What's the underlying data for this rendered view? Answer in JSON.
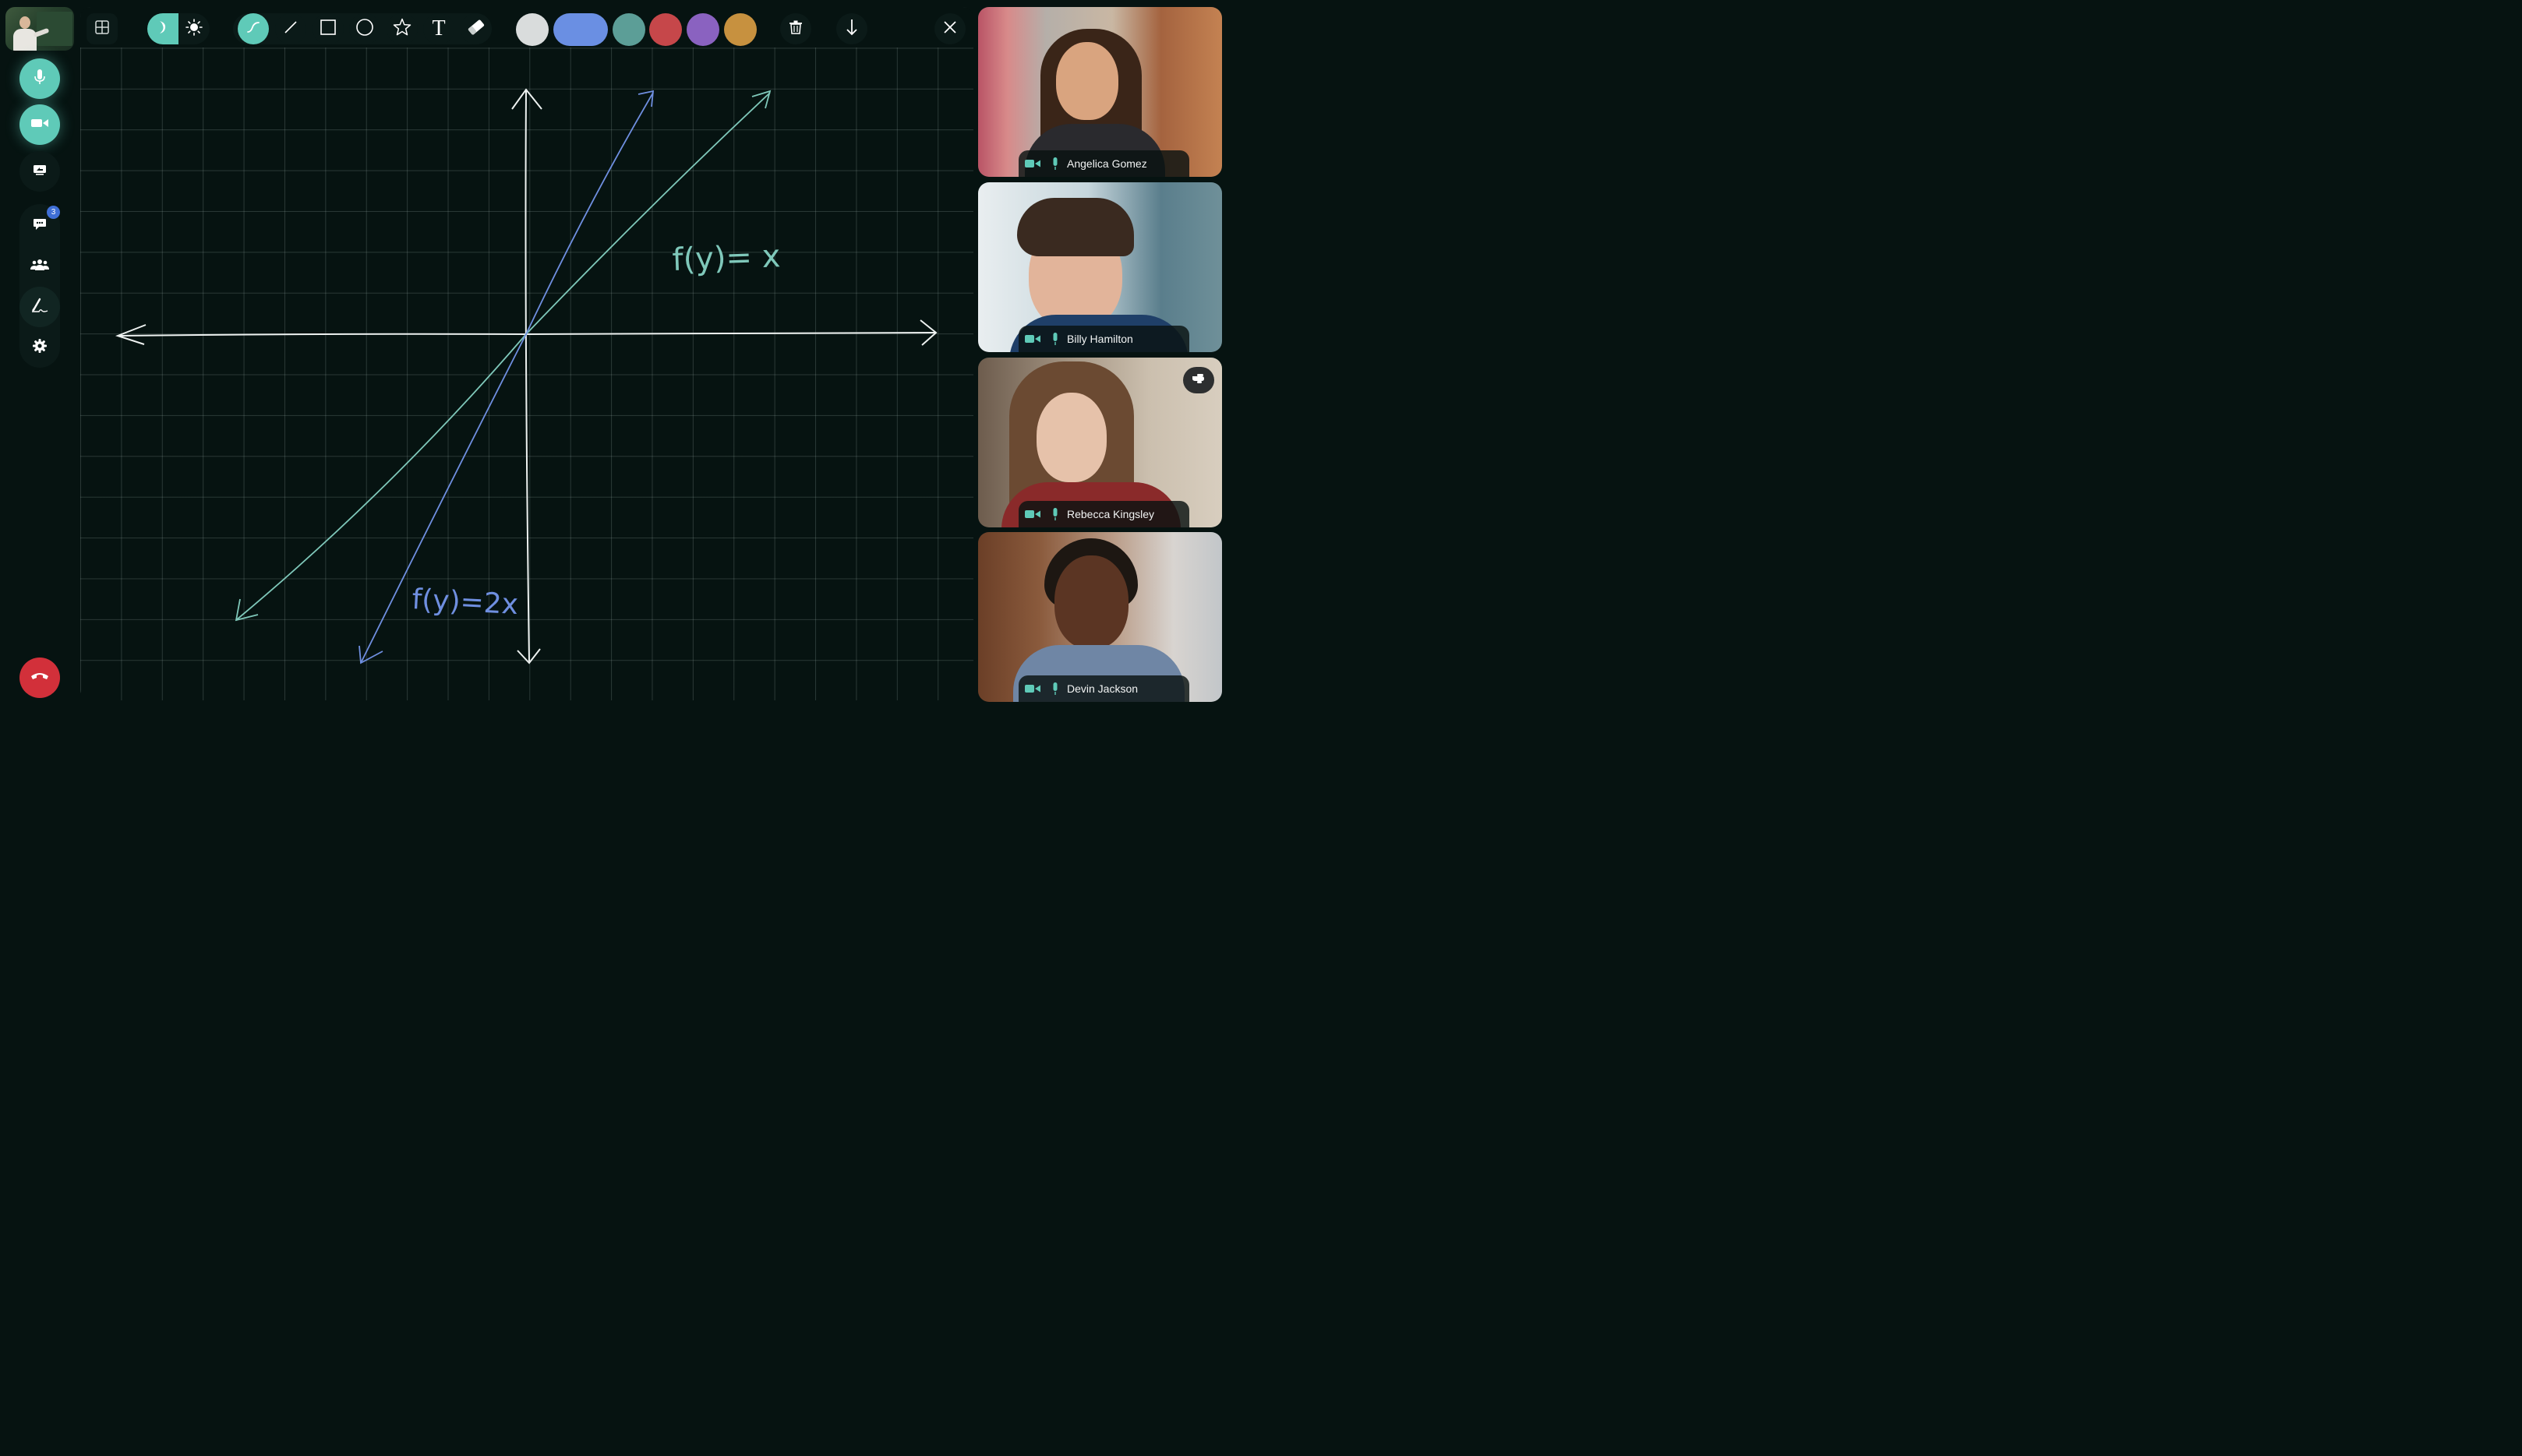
{
  "rail": {
    "self_thumbnail": "self-video-thumbnail",
    "buttons": [
      {
        "name": "microphone",
        "icon": "microphone-icon",
        "state": "on"
      },
      {
        "name": "camera",
        "icon": "video-camera-icon",
        "state": "on"
      },
      {
        "name": "screen-share",
        "icon": "screen-share-icon"
      },
      {
        "name": "chat",
        "icon": "chat-bubble-icon",
        "badge": "3"
      },
      {
        "name": "participants",
        "icon": "people-icon"
      },
      {
        "name": "whiteboard",
        "icon": "whiteboard-pen-icon",
        "state": "active"
      },
      {
        "name": "settings",
        "icon": "gear-icon"
      },
      {
        "name": "end-call",
        "icon": "phone-hangup-icon"
      }
    ]
  },
  "toolbar": {
    "tools": [
      {
        "name": "grid",
        "icon": "grid-icon"
      },
      {
        "name": "dark-mode",
        "icon": "moon-icon",
        "selected": true
      },
      {
        "name": "light-mode",
        "icon": "sun-icon"
      },
      {
        "name": "freehand",
        "icon": "pen-curve-icon",
        "selected": true
      },
      {
        "name": "line",
        "icon": "line-icon"
      },
      {
        "name": "rectangle",
        "icon": "square-icon"
      },
      {
        "name": "circle",
        "icon": "circle-icon"
      },
      {
        "name": "star",
        "icon": "star-icon"
      },
      {
        "name": "text",
        "icon": "text-icon",
        "glyph": "T"
      },
      {
        "name": "eraser",
        "icon": "eraser-icon"
      },
      {
        "name": "delete",
        "icon": "trash-icon"
      },
      {
        "name": "download",
        "icon": "download-arrow-icon"
      },
      {
        "name": "close",
        "icon": "close-icon"
      }
    ],
    "colors": [
      {
        "name": "white",
        "hex": "#d9dcdc"
      },
      {
        "name": "blue",
        "hex": "#6a8fe3",
        "selected": true
      },
      {
        "name": "teal",
        "hex": "#5c9e97"
      },
      {
        "name": "red",
        "hex": "#c6474a"
      },
      {
        "name": "purple",
        "hex": "#8a62c0"
      },
      {
        "name": "gold",
        "hex": "#c7913f"
      }
    ]
  },
  "board": {
    "annotations": [
      {
        "name": "label-f-of-y-equals-x",
        "text": "f(y)= x",
        "color": "#7fc8ba"
      },
      {
        "name": "label-f-of-y-equals-2x",
        "text": "f(y)=2x",
        "color": "#6f8fe0"
      }
    ],
    "lines": [
      {
        "name": "line-y-equals-x",
        "color": "#7fc8ba"
      },
      {
        "name": "line-y-equals-2x",
        "color": "#6f8fe0"
      }
    ],
    "axis_color": "#eef2f1"
  },
  "participants": [
    {
      "name": "Angelica Gomez"
    },
    {
      "name": "Billy Hamilton"
    },
    {
      "name": "Rebecca Kingsley",
      "hand_raised": true
    },
    {
      "name": "Devin Jackson"
    }
  ],
  "colors": {
    "accent": "#5fcab8",
    "end_call": "#d2303a",
    "badge": "#3f6fd6",
    "background": "#061311"
  }
}
